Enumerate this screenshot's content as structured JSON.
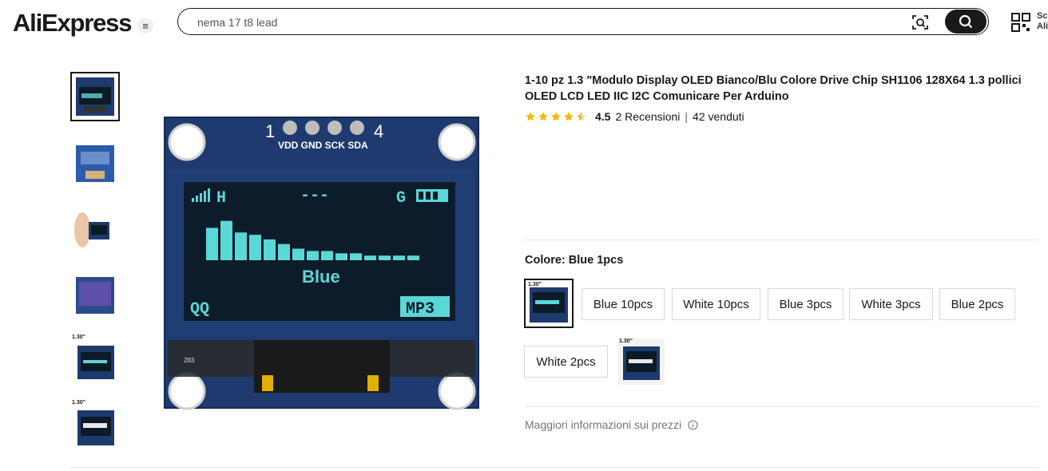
{
  "header": {
    "logo": "AliExpress",
    "menu_icon": "hamburger-icon",
    "search_value": "nema 17 t8 lead",
    "side_text_1": "Sc",
    "side_text_2": "Ali"
  },
  "product": {
    "title": "1-10 pz 1.3 \"Modulo Display OLED Bianco/Blu Colore Drive Chip SH1106 128X64 1.3 pollici OLED LCD LED IIC I2C Comunicare Per Arduino",
    "rating": "4.5",
    "rating_value": 4.5,
    "reviews": "2 Recensioni",
    "separator": "|",
    "sold": "42 venduti",
    "color_label": "Colore: Blue 1pcs",
    "price_info": "Maggiori informazioni sui prezzi"
  },
  "display": {
    "pins_left": "1",
    "pins_right": "4",
    "pin_labels": "VDD GND SCK SDA",
    "signal": "H",
    "dashes": "---",
    "g": "G",
    "blue": "Blue",
    "qq": "QQ",
    "mp3": "MP3",
    "board_number": "283",
    "thumb_size_label": "1.30\"",
    "bars": [
      14,
      17,
      12,
      11,
      9,
      7,
      5,
      4,
      4,
      3,
      3,
      2,
      2,
      2,
      2
    ]
  },
  "options": [
    {
      "label": "Blue 10pcs"
    },
    {
      "label": "White 10pcs"
    },
    {
      "label": "Blue 3pcs"
    },
    {
      "label": "White 3pcs"
    },
    {
      "label": "Blue 2pcs"
    },
    {
      "label": "White 2pcs"
    }
  ],
  "colors": {
    "oled_cyan": "#5ad7d7",
    "pcb_blue": "#1e3a6e",
    "star": "#f5b800"
  }
}
